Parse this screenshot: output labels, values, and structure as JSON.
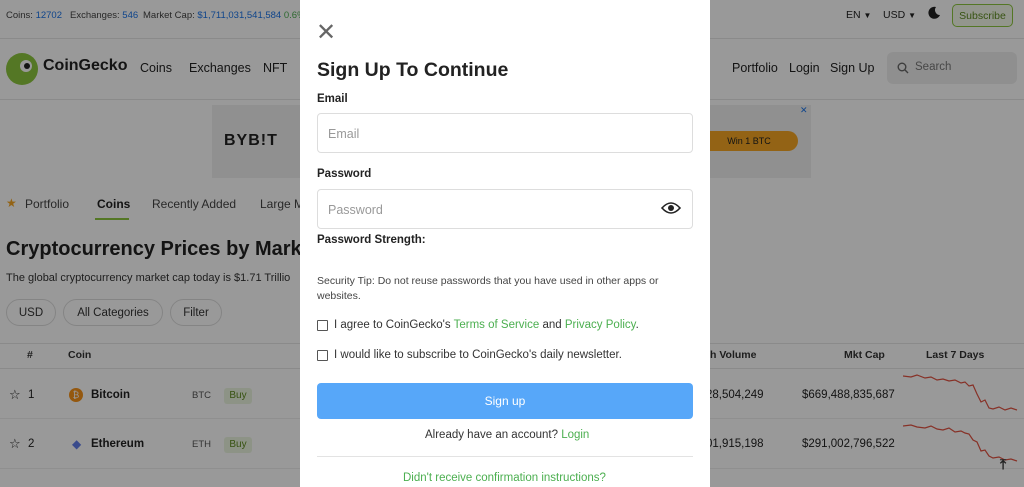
{
  "stats": {
    "coins_label": "Coins:",
    "coins_value": "12702",
    "exchanges_label": "Exchanges:",
    "exchanges_value": "546",
    "marketcap_label": "Market Cap:",
    "marketcap_value": "$1,711,031,541,584",
    "marketcap_change": "0.6%"
  },
  "topbar": {
    "language": "EN",
    "currency": "USD",
    "subscribe_label": "Subscribe"
  },
  "nav": {
    "brand": "CoinGecko",
    "items": [
      "Coins",
      "Exchanges",
      "NFT"
    ],
    "right_items": [
      "Portfolio",
      "Login",
      "Sign Up"
    ],
    "search_placeholder": "Search"
  },
  "ad": {
    "brand": "BYB!T",
    "button": "Win 1 BTC"
  },
  "tabs": [
    "Portfolio",
    "Coins",
    "Recently Added",
    "Large M"
  ],
  "page": {
    "title": "Cryptocurrency Prices by Marke",
    "subtitle": "The global cryptocurrency market cap today is $1.71 Trillio"
  },
  "filters": [
    "USD",
    "All Categories",
    "Filter"
  ],
  "table": {
    "headers": {
      "rank": "#",
      "coin": "Coin",
      "volume": "h Volume",
      "mcap": "Mkt Cap",
      "last7": "Last 7 Days"
    },
    "buy_label": "Buy",
    "rows": [
      {
        "rank": "1",
        "name": "Bitcoin",
        "symbol": "BTC",
        "volume": "28,504,249",
        "mcap": "$669,488,835,687"
      },
      {
        "rank": "2",
        "name": "Ethereum",
        "symbol": "ETH",
        "volume": "01,915,198",
        "mcap": "$291,002,796,522"
      }
    ]
  },
  "modal": {
    "title": "Sign Up To Continue",
    "email_label": "Email",
    "email_placeholder": "Email",
    "password_label": "Password",
    "password_placeholder": "Password",
    "strength_label": "Password Strength:",
    "security_tip": "Security Tip: Do not reuse passwords that you have used in other apps or websites.",
    "agree_prefix": "I agree to CoinGecko's",
    "terms_link": "Terms of Service",
    "and_text": "and",
    "privacy_link": "Privacy Policy",
    "period": ".",
    "newsletter_text": "I would like to subscribe to CoinGecko's daily newsletter.",
    "signup_button": "Sign up",
    "have_account_text": "Already have an account?",
    "login_link": "Login",
    "confirm_link": "Didn't receive confirmation instructions?"
  },
  "colors": {
    "accent_blue": "#57a7f9",
    "link_green": "#4caf50",
    "brand_green": "#8dc63f"
  }
}
